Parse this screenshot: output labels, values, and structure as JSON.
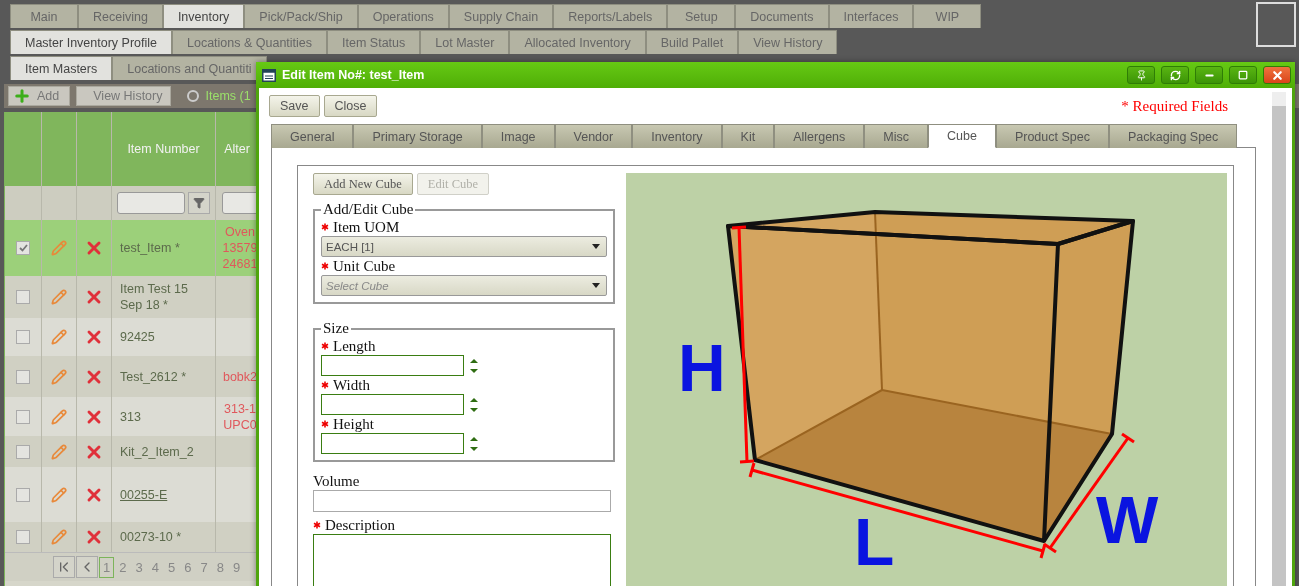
{
  "main_tabs": [
    {
      "label": "Main",
      "selected": false
    },
    {
      "label": "Receiving",
      "selected": false
    },
    {
      "label": "Inventory",
      "selected": true
    },
    {
      "label": "Pick/Pack/Ship",
      "selected": false
    },
    {
      "label": "Operations",
      "selected": false
    },
    {
      "label": "Supply Chain",
      "selected": false
    },
    {
      "label": "Reports/Labels",
      "selected": false
    },
    {
      "label": "Setup",
      "selected": false
    },
    {
      "label": "Documents",
      "selected": false
    },
    {
      "label": "Interfaces",
      "selected": false
    },
    {
      "label": "WIP",
      "selected": false
    }
  ],
  "sub_tabs": [
    {
      "label": "Master Inventory Profile",
      "selected": true
    },
    {
      "label": "Locations & Quantities",
      "selected": false
    },
    {
      "label": "Item Status",
      "selected": false
    },
    {
      "label": "Lot Master",
      "selected": false
    },
    {
      "label": "Allocated Inventory",
      "selected": false
    },
    {
      "label": "Build Pallet",
      "selected": false
    },
    {
      "label": "View History",
      "selected": false
    }
  ],
  "page_tabs": [
    {
      "label": "Item Masters",
      "selected": true
    },
    {
      "label": "Locations and Quantiti",
      "selected": false
    }
  ],
  "toolbar": {
    "buttons": [
      {
        "label": "Add",
        "kind": "add"
      },
      {
        "label": "View History",
        "kind": "plain"
      }
    ],
    "filter_label": "Items (1"
  },
  "grid": {
    "columns": [
      "Item Number",
      "Alter"
    ],
    "rows": [
      {
        "item": "test_Item *",
        "alt": [
          "Oven",
          "13579",
          "24681"
        ],
        "checked": true,
        "selected": true,
        "link": false
      },
      {
        "item": "Item Test 15 Sep 18 *",
        "alt": [],
        "checked": false,
        "selected": false,
        "link": false
      },
      {
        "item": "92425",
        "alt": [],
        "checked": false,
        "selected": false,
        "link": false
      },
      {
        "item": "Test_2612 *",
        "alt": [
          "bobk2"
        ],
        "checked": false,
        "selected": false,
        "link": false
      },
      {
        "item": "313",
        "alt": [
          "313-1",
          "UPC0"
        ],
        "checked": false,
        "selected": false,
        "link": false
      },
      {
        "item": "Kit_2_Item_2",
        "alt": [],
        "checked": false,
        "selected": false,
        "link": false
      },
      {
        "item": "00255-E",
        "alt": [],
        "checked": false,
        "selected": false,
        "link": true
      },
      {
        "item": "00273-10 *",
        "alt": [],
        "checked": false,
        "selected": false,
        "link": false
      }
    ],
    "pages": [
      {
        "label": "1",
        "selected": true
      },
      {
        "label": "2",
        "selected": false
      },
      {
        "label": "3",
        "selected": false
      },
      {
        "label": "4",
        "selected": false
      },
      {
        "label": "5",
        "selected": false
      },
      {
        "label": "6",
        "selected": false
      },
      {
        "label": "7",
        "selected": false
      },
      {
        "label": "8",
        "selected": false
      },
      {
        "label": "9",
        "selected": false
      }
    ]
  },
  "dialog": {
    "title": "Edit Item No#: test_Item",
    "buttons": [
      "Save",
      "Close"
    ],
    "required_note": "* Required Fields",
    "tabs": [
      {
        "label": "General",
        "selected": false
      },
      {
        "label": "Primary Storage",
        "selected": false
      },
      {
        "label": "Image",
        "selected": false
      },
      {
        "label": "Vendor",
        "selected": false
      },
      {
        "label": "Inventory",
        "selected": false
      },
      {
        "label": "Kit",
        "selected": false
      },
      {
        "label": "Allergens",
        "selected": false
      },
      {
        "label": "Misc",
        "selected": false
      },
      {
        "label": "Cube",
        "selected": true
      },
      {
        "label": "Product Spec",
        "selected": false
      },
      {
        "label": "Packaging Spec",
        "selected": false
      }
    ],
    "cube_buttons": [
      {
        "label": "Add New Cube",
        "disabled": false
      },
      {
        "label": "Edit Cube",
        "disabled": true
      }
    ],
    "cube_group": {
      "legend": "Add/Edit Cube",
      "fields": [
        {
          "label": "Item UOM",
          "required": true,
          "value": "EACH [1]"
        },
        {
          "label": "Unit Cube",
          "required": true,
          "placeholder": "Select Cube"
        }
      ]
    },
    "size_group": {
      "legend": "Size",
      "fields": [
        {
          "label": "Length",
          "required": true
        },
        {
          "label": "Width",
          "required": true
        },
        {
          "label": "Height",
          "required": true
        }
      ]
    },
    "volume": {
      "label": "Volume",
      "required": false
    },
    "description": {
      "label": "Description",
      "required": true
    },
    "diagram": {
      "labels": [
        "H",
        "L",
        "W"
      ]
    }
  }
}
